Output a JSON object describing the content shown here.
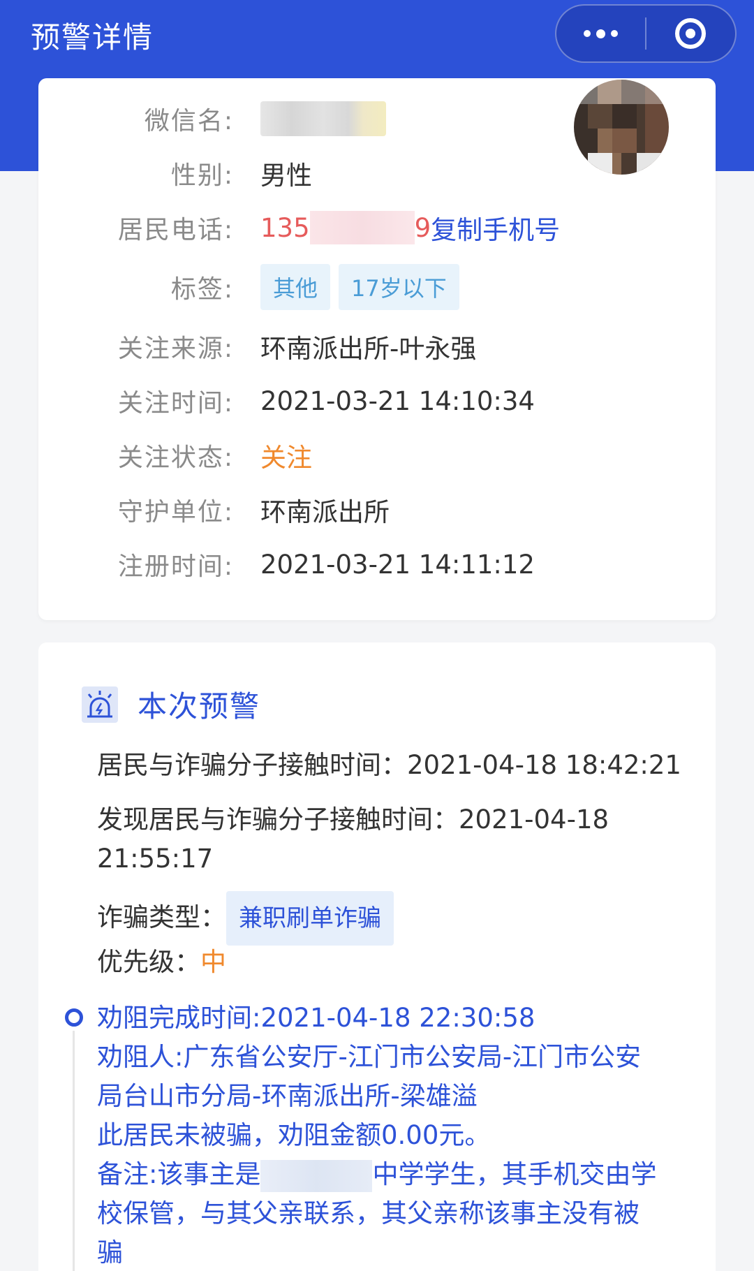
{
  "nav": {
    "title": "预警详情"
  },
  "profile": {
    "wechat_label": "微信名:",
    "gender_label": "性别:",
    "gender_value": "男性",
    "phone_label": "居民电话:",
    "phone_prefix": "135",
    "phone_suffix": "9",
    "copy_phone": "复制手机号",
    "tags_label": "标签:",
    "tags": [
      "其他",
      "17岁以下"
    ],
    "source_label": "关注来源:",
    "source_value": "环南派出所-叶永强",
    "follow_time_label": "关注时间:",
    "follow_time_value": "2021-03-21 14:10:34",
    "status_label": "关注状态:",
    "status_value": "关注",
    "guard_label": "守护单位:",
    "guard_value": "环南派出所",
    "register_label": "注册时间:",
    "register_value": "2021-03-21 14:11:12"
  },
  "alert": {
    "title": "本次预警",
    "contact_time": "居民与诈骗分子接触时间：2021-04-18 18:42:21",
    "found_line1": "发现居民与诈骗分子接触时间：2021-04-18",
    "found_line2": "21:55:17",
    "fraud_type_label": "诈骗类型：",
    "fraud_type_value": "兼职刷单诈骗",
    "priority_label": "优先级：",
    "priority_value": "中",
    "persuade_time": "劝阻完成时间:2021-04-18 22:30:58",
    "persuader_line1": "劝阻人:广东省公安厅-江门市公安局-江门市公安",
    "persuader_line2": "局台山市分局-环南派出所-梁雄溢",
    "result": "此居民未被骗，劝阻金额0.00元。",
    "note_prefix": "备注:该事主是",
    "note_rest1": "中学学生，其手机交由学",
    "note_line2": "校保管，与其父亲联系，其父亲称该事主没有被",
    "note_line3": "骗"
  },
  "colors": {
    "brand_blue": "#2d52d8",
    "phone_red": "#e65b5b",
    "status_orange": "#f0892d"
  }
}
